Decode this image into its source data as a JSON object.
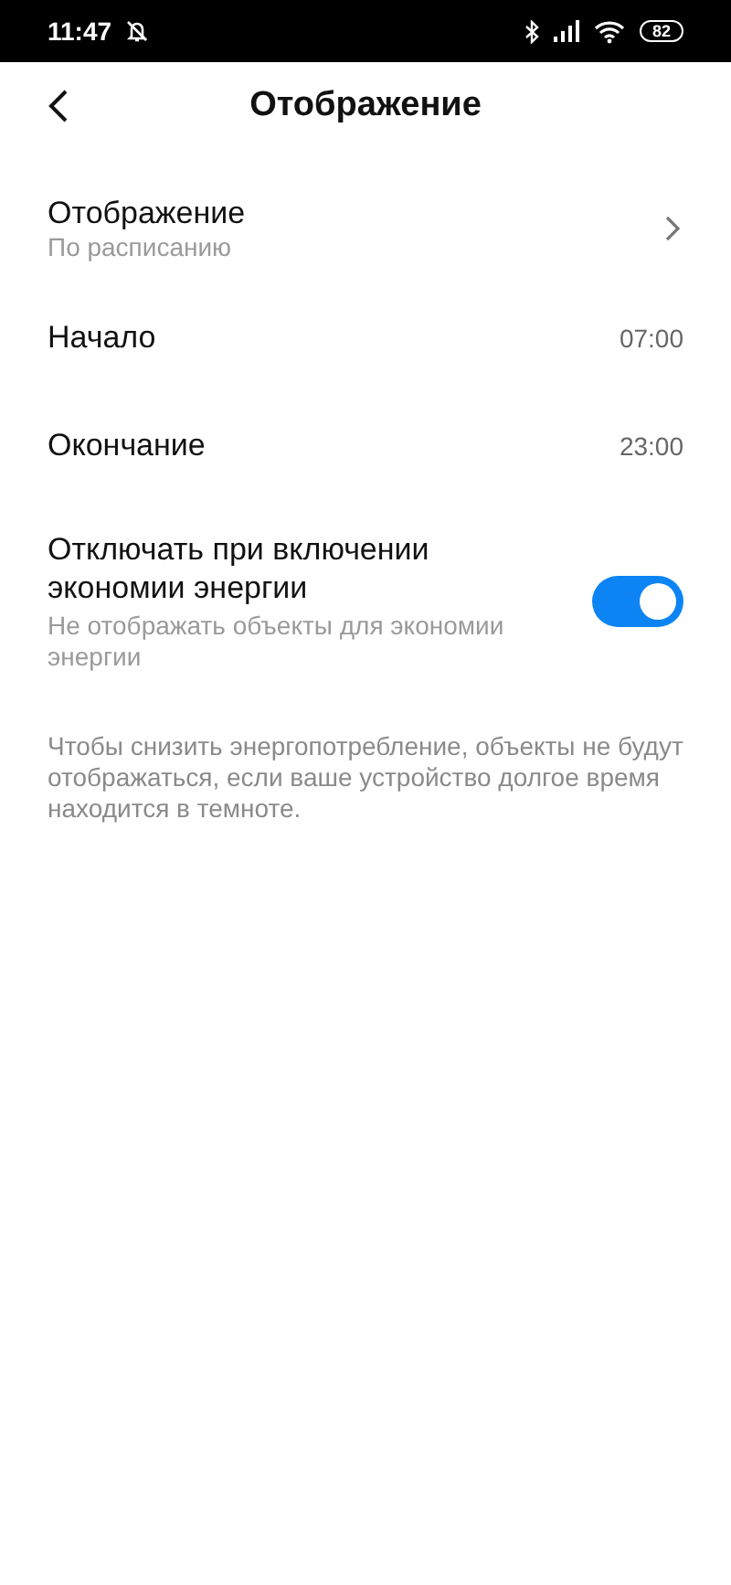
{
  "status_bar": {
    "time": "11:47",
    "battery": "82"
  },
  "header": {
    "title": "Отображение"
  },
  "rows": [
    {
      "kind": "nav",
      "title": "Отображение",
      "subtitle": "По расписанию"
    },
    {
      "kind": "value",
      "title": "Начало",
      "value": "07:00"
    },
    {
      "kind": "value",
      "title": "Окончание",
      "value": "23:00"
    },
    {
      "kind": "switch",
      "title": "Отключать при включении экономии энергии",
      "subtitle": "Не отображать объекты для экономии энергии",
      "on": true
    }
  ],
  "footer_note": "Чтобы снизить энергопотребление, объекты не будут отображаться, если ваше устройство долгое время находится в темноте."
}
